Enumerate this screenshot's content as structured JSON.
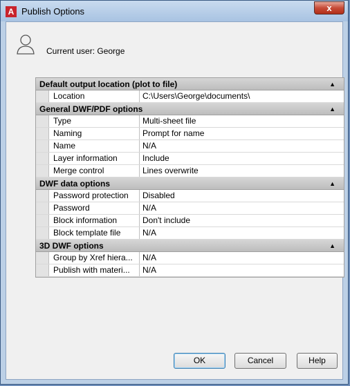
{
  "window": {
    "title": "Publish Options",
    "close_glyph": "x",
    "app_icon": "autocad-icon"
  },
  "user": {
    "label": "Current user: George",
    "icon": "user-icon"
  },
  "sections": [
    {
      "title": "Default output location (plot to file)",
      "rows": [
        {
          "key": "Location",
          "value": "C:\\Users\\George\\documents\\"
        }
      ]
    },
    {
      "title": "General DWF/PDF options",
      "rows": [
        {
          "key": "Type",
          "value": "Multi-sheet file"
        },
        {
          "key": "Naming",
          "value": "Prompt for name"
        },
        {
          "key": "Name",
          "value": "N/A"
        },
        {
          "key": "Layer information",
          "value": "Include"
        },
        {
          "key": "Merge control",
          "value": "Lines overwrite"
        }
      ]
    },
    {
      "title": "DWF data options",
      "rows": [
        {
          "key": "Password protection",
          "value": "Disabled"
        },
        {
          "key": "Password",
          "value": "N/A"
        },
        {
          "key": "Block information",
          "value": "Don't include"
        },
        {
          "key": "Block template file",
          "value": "N/A"
        }
      ]
    },
    {
      "title": "3D DWF options",
      "rows": [
        {
          "key": "Group by Xref hiera...",
          "value": "N/A"
        },
        {
          "key": "Publish with materi...",
          "value": "N/A"
        }
      ]
    }
  ],
  "collapse_glyph": "▲",
  "buttons": {
    "ok": "OK",
    "cancel": "Cancel",
    "help": "Help"
  }
}
